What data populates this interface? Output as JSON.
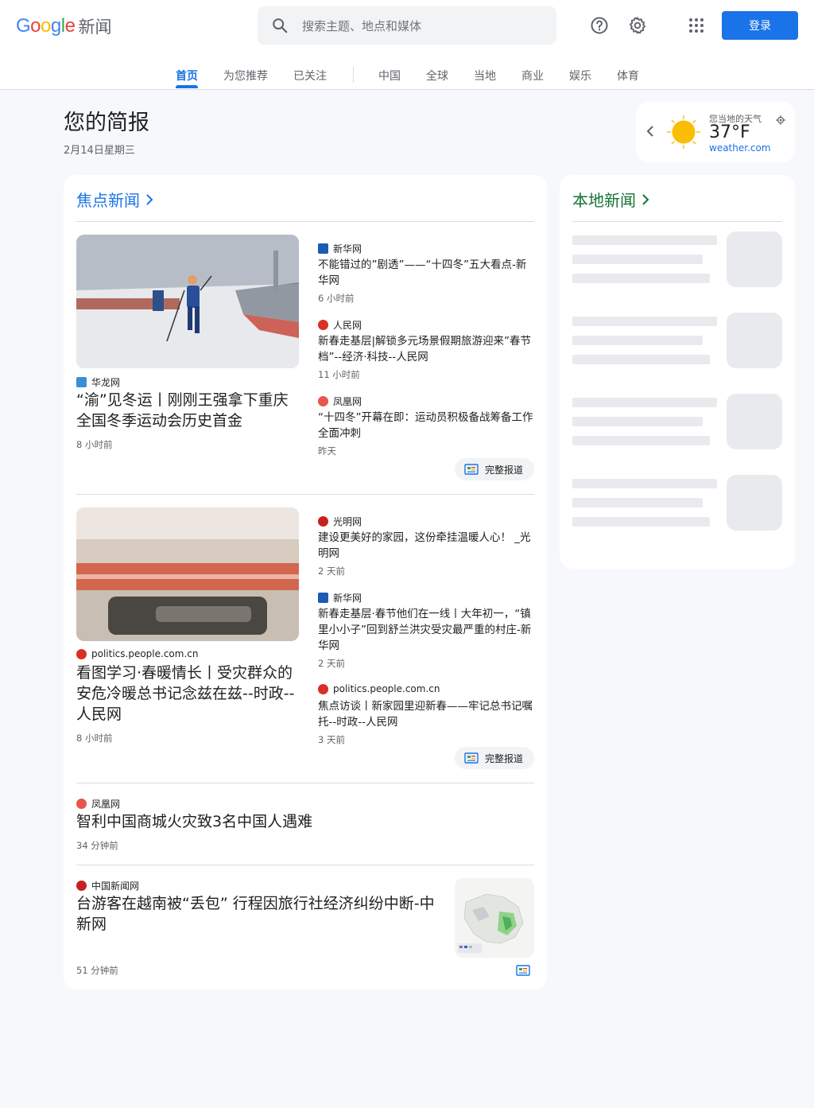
{
  "header": {
    "logo_text": "Google",
    "logo_product": "新闻",
    "search_placeholder": "搜索主题、地点和媒体",
    "signin_label": "登录",
    "icons": [
      "help-icon",
      "settings-icon",
      "apps-icon",
      "search-icon"
    ]
  },
  "nav": {
    "tabs": [
      "首页",
      "为您推荐",
      "已关注",
      "中国",
      "全球",
      "当地",
      "商业",
      "娱乐",
      "体育"
    ],
    "active": "首页"
  },
  "briefing": {
    "title": "您的简报",
    "date": "2月14日星期三"
  },
  "weather": {
    "label": "您当地的天气",
    "temperature": "37°F",
    "source": "weather.com"
  },
  "top_stories": {
    "title": "焦点新闻",
    "clusters": [
      {
        "main": {
          "source": "华龙网",
          "headline": "“渝”见冬运丨刚刚王强拿下重庆全国冬季运动会历史首金",
          "time": "8 小时前"
        },
        "related": [
          {
            "source": "新华网",
            "headline": "不能错过的”剧透”——“十四冬”五大看点-新华网",
            "time": "6 小时前"
          },
          {
            "source": "人民网",
            "headline": "新春走基层|解锁多元场景假期旅游迎来”春节档”--经济·科技--人民网",
            "time": "11 小时前"
          },
          {
            "source": "凤凰网",
            "headline": "“十四冬”开幕在即：运动员积极备战筹备工作全面冲刺",
            "time": "昨天"
          }
        ],
        "full_coverage": "完整报道"
      },
      {
        "main": {
          "source": "politics.people.com.cn",
          "headline": "看图学习·春暖情长丨受灾群众的安危冷暖总书记念兹在兹--时政--人民网",
          "time": "8 小时前"
        },
        "related": [
          {
            "source": "光明网",
            "headline": "建设更美好的家园，这份牵挂温暖人心！ _光明网",
            "time": "2 天前"
          },
          {
            "source": "新华网",
            "headline": "新春走基层·春节他们在一线丨大年初一，“镇里小小子”回到舒兰洪灾受灾最严重的村庄-新华网",
            "time": "2 天前"
          },
          {
            "source": "politics.people.com.cn",
            "headline": "焦点访谈丨新家园里迎新春——牢记总书记嘱托--时政--人民网",
            "time": "3 天前"
          }
        ],
        "full_coverage": "完整报道"
      }
    ],
    "singles": [
      {
        "source": "凤凰网",
        "headline": "智利中国商城火灾致3名中国人遇难",
        "time": "34 分钟前"
      },
      {
        "source": "中国新闻网",
        "headline": "台游客在越南被“丢包” 行程因旅行社经济纠纷中断-中新网",
        "time": "51 分钟前"
      }
    ]
  },
  "local": {
    "title": "本地新闻"
  },
  "colors": {
    "accent": "#1a73e8",
    "local_title": "#137333",
    "page_bg": "#f6f8fc"
  }
}
